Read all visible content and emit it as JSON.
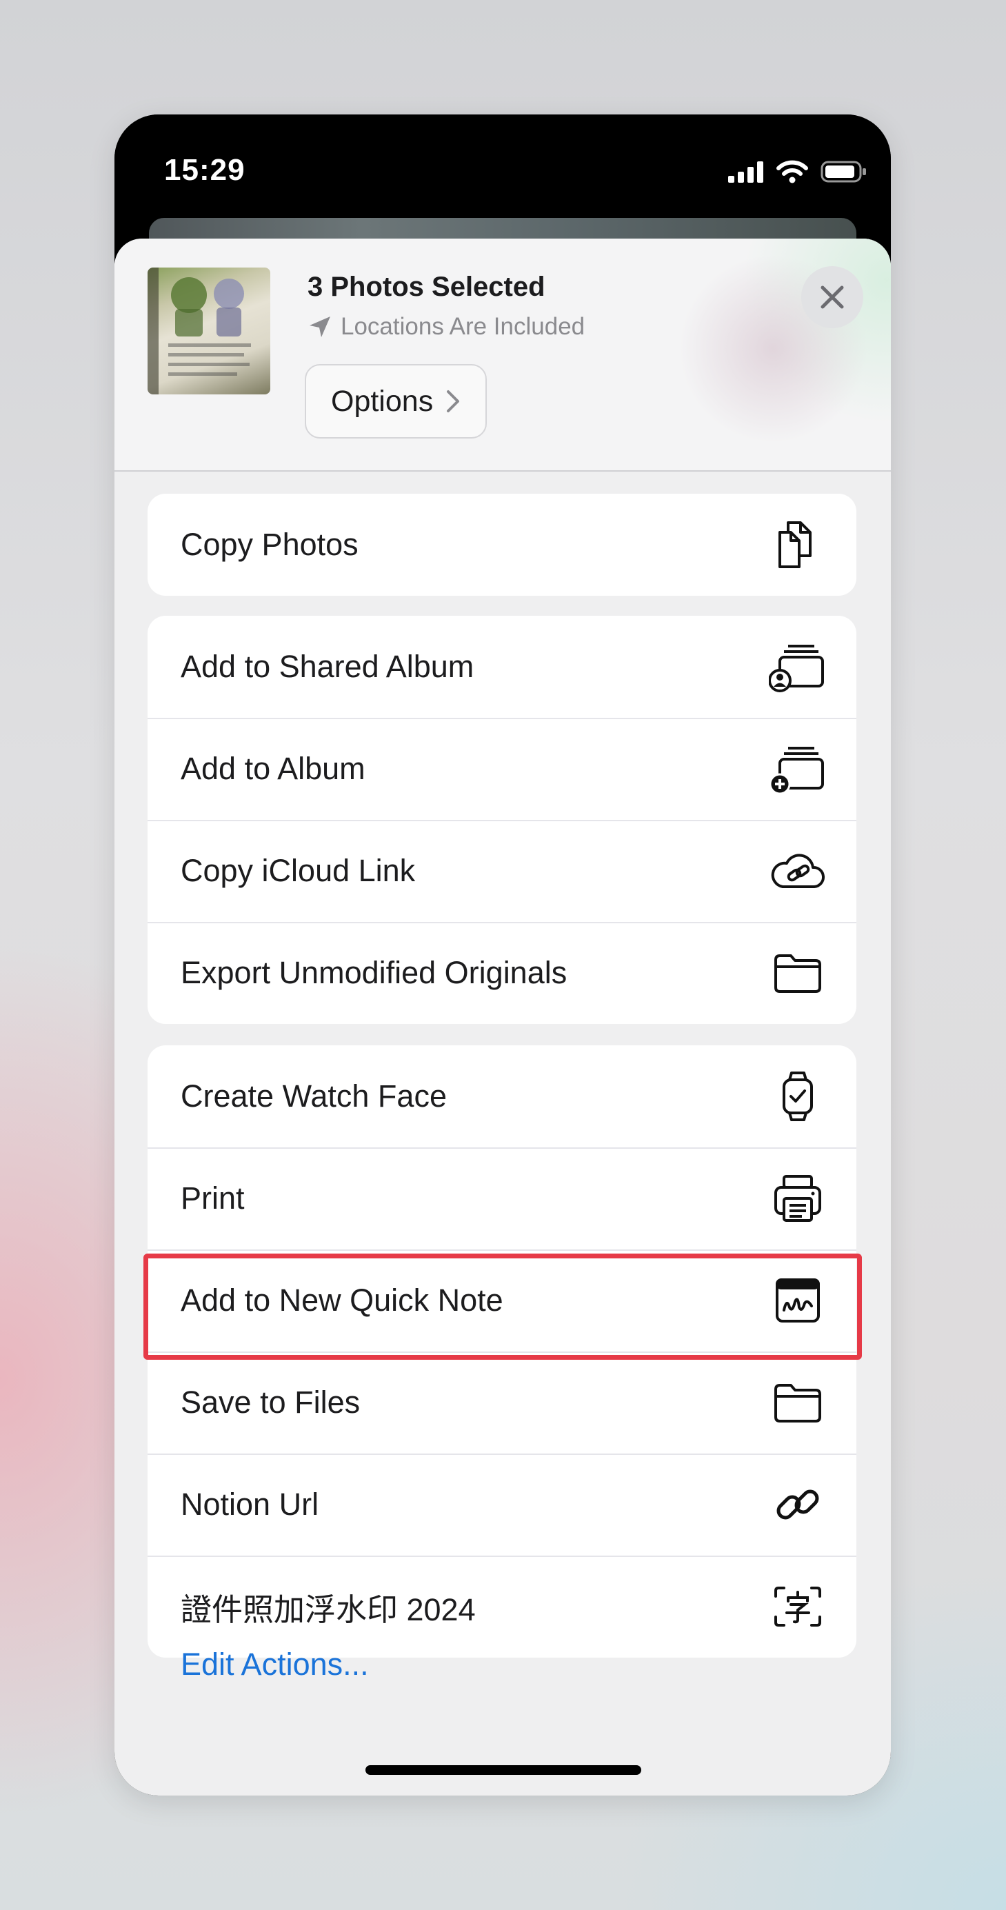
{
  "status_bar": {
    "time": "15:29",
    "icons": [
      "signal-icon",
      "wifi-icon",
      "battery-icon"
    ]
  },
  "header": {
    "title": "3 Photos Selected",
    "subtitle": "Locations Are Included",
    "options_label": "Options",
    "close_icon": "close-icon"
  },
  "groups": [
    {
      "items": [
        {
          "label": "Copy Photos",
          "icon": "copy-icon"
        }
      ]
    },
    {
      "items": [
        {
          "label": "Add to Shared Album",
          "icon": "shared-album-icon"
        },
        {
          "label": "Add to Album",
          "icon": "add-album-icon"
        },
        {
          "label": "Copy iCloud Link",
          "icon": "icloud-link-icon"
        },
        {
          "label": "Export Unmodified Originals",
          "icon": "folder-icon"
        }
      ]
    },
    {
      "items": [
        {
          "label": "Create Watch Face",
          "icon": "watch-icon"
        },
        {
          "label": "Print",
          "icon": "printer-icon"
        },
        {
          "label": "Add to New Quick Note",
          "icon": "quick-note-icon"
        },
        {
          "label": "Save to Files",
          "icon": "folder-icon"
        },
        {
          "label": "Notion Url",
          "icon": "link-icon"
        },
        {
          "label": "證件照加浮水印 2024",
          "icon": "text-recognition-icon"
        }
      ]
    }
  ],
  "edit_actions_label": "Edit Actions...",
  "highlighted_item": "Print",
  "colors": {
    "accent": "#1a73d9",
    "highlight": "#e63a47"
  }
}
